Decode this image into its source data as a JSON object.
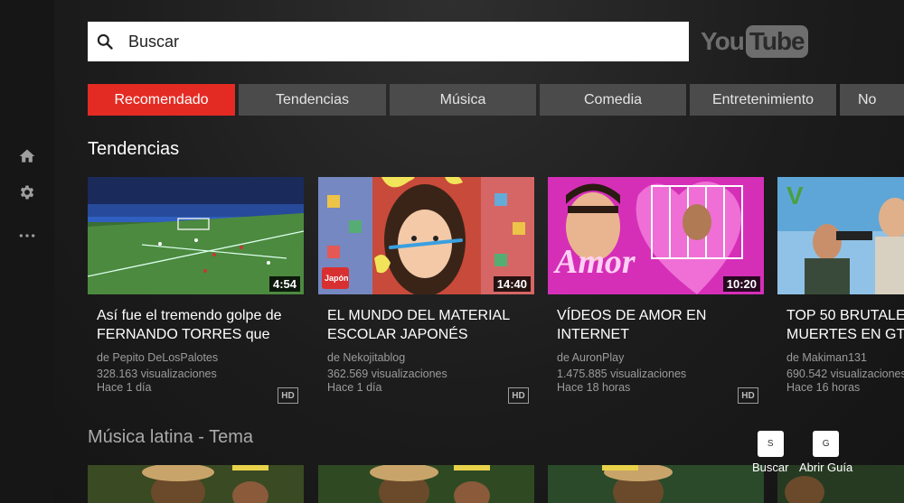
{
  "search": {
    "placeholder": "Buscar"
  },
  "logo": {
    "you": "You",
    "tube": "Tube"
  },
  "tabs": [
    {
      "label": "Recomendado",
      "active": true
    },
    {
      "label": "Tendencias"
    },
    {
      "label": "Música"
    },
    {
      "label": "Comedia"
    },
    {
      "label": "Entretenimiento"
    },
    {
      "label": "No"
    }
  ],
  "sections": {
    "trending": "Tendencias",
    "latin": "Música latina - Tema"
  },
  "videos": [
    {
      "title_line1": "Así fue el tremendo golpe de",
      "title_line2": "FERNANDO TORRES que",
      "channel": "de Pepito DeLosPalotes",
      "views": "328.163 visualizaciones",
      "age": "Hace 1 día",
      "duration": "4:54",
      "hd": "HD"
    },
    {
      "title_line1": "EL MUNDO DEL MATERIAL",
      "title_line2": "ESCOLAR JAPONÉS",
      "channel": "de Nekojitablog",
      "views": "362.569 visualizaciones",
      "age": "Hace 1 día",
      "duration": "14:40",
      "hd": "HD"
    },
    {
      "title_line1": "VÍDEOS DE AMOR EN",
      "title_line2": "INTERNET",
      "channel": "de AuronPlay",
      "views": "1.475.885 visualizaciones",
      "age": "Hace 18 horas",
      "duration": "10:20",
      "hd": "HD"
    },
    {
      "title_line1": "TOP 50 BRUTALE",
      "title_line2": "MUERTES EN GTA",
      "channel": "de Makiman131",
      "views": "690.542 visualizaciones",
      "age": "Hace 16 horas"
    }
  ],
  "thumb_text": {
    "japon_badge": "Japón",
    "amor": "Amor"
  },
  "shortcuts": [
    {
      "key": "S",
      "label": "Buscar"
    },
    {
      "key": "G",
      "label": "Abrir Guía"
    }
  ],
  "colors": {
    "accent": "#e42b23",
    "tab_bg": "#4b4b4b",
    "background": "#1c1c1c"
  }
}
